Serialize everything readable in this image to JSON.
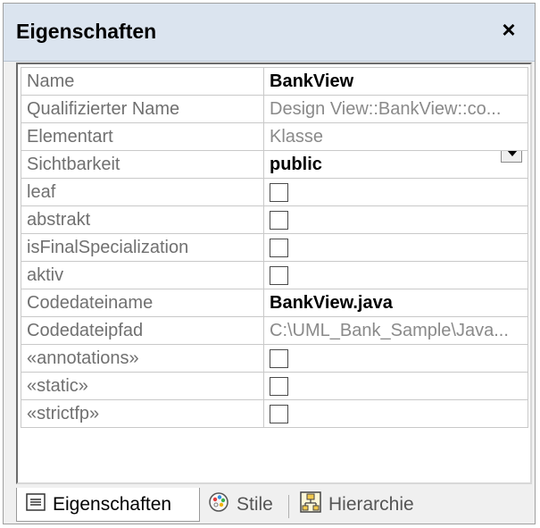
{
  "window": {
    "title": "Eigenschaften",
    "close_glyph": "×"
  },
  "properties": [
    {
      "label": "Name",
      "value": "BankView",
      "kind": "edit"
    },
    {
      "label": "Qualifizierter Name",
      "value": "Design View::BankView::co...",
      "kind": "ro"
    },
    {
      "label": "Elementart",
      "value": "Klasse",
      "kind": "ro"
    },
    {
      "label": "Sichtbarkeit",
      "value": "public",
      "kind": "select"
    },
    {
      "label": "leaf",
      "value": "",
      "kind": "checkbox"
    },
    {
      "label": "abstrakt",
      "value": "",
      "kind": "checkbox"
    },
    {
      "label": "isFinalSpecialization",
      "value": "",
      "kind": "checkbox"
    },
    {
      "label": "aktiv",
      "value": "",
      "kind": "checkbox"
    },
    {
      "label": "Codedateiname",
      "value": "BankView.java",
      "kind": "edit"
    },
    {
      "label": "Codedateipfad",
      "value": "C:\\UML_Bank_Sample\\Java...",
      "kind": "ro"
    },
    {
      "label": "«annotations»",
      "value": "",
      "kind": "checkbox"
    },
    {
      "label": "«static»",
      "value": "",
      "kind": "checkbox"
    },
    {
      "label": "«strictfp»",
      "value": "",
      "kind": "checkbox"
    }
  ],
  "tabs": [
    {
      "label": "Eigenschaften",
      "icon": "list-icon",
      "active": true
    },
    {
      "label": "Stile",
      "icon": "palette-icon",
      "active": false
    },
    {
      "label": "Hierarchie",
      "icon": "hierarchy-icon",
      "active": false
    }
  ]
}
